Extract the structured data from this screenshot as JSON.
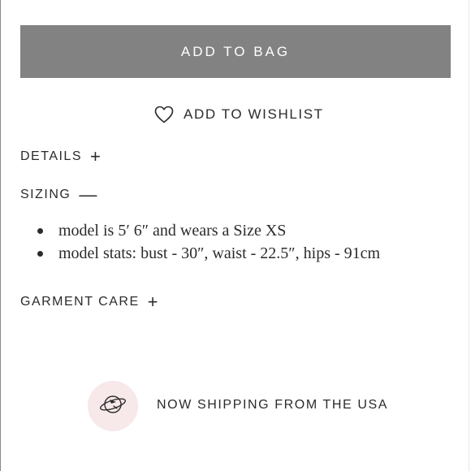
{
  "product": {
    "add_to_bag_label": "ADD TO BAG",
    "wishlist_label": "ADD TO WISHLIST"
  },
  "accordions": {
    "details": {
      "label": "DETAILS",
      "state_sign": "+"
    },
    "sizing": {
      "label": "SIZING",
      "state_sign": "—",
      "items": [
        "model is 5′ 6″ and wears a Size XS",
        "model stats: bust - 30″, waist - 22.5″, hips - 91cm"
      ]
    },
    "garment_care": {
      "label": "GARMENT CARE",
      "state_sign": "+"
    }
  },
  "shipping": {
    "label": "NOW SHIPPING FROM THE USA",
    "icon": "plane-globe-icon"
  },
  "colors": {
    "button_bg": "#828282",
    "badge_bg": "#f7e8ea",
    "text": "#2b2b2b"
  }
}
